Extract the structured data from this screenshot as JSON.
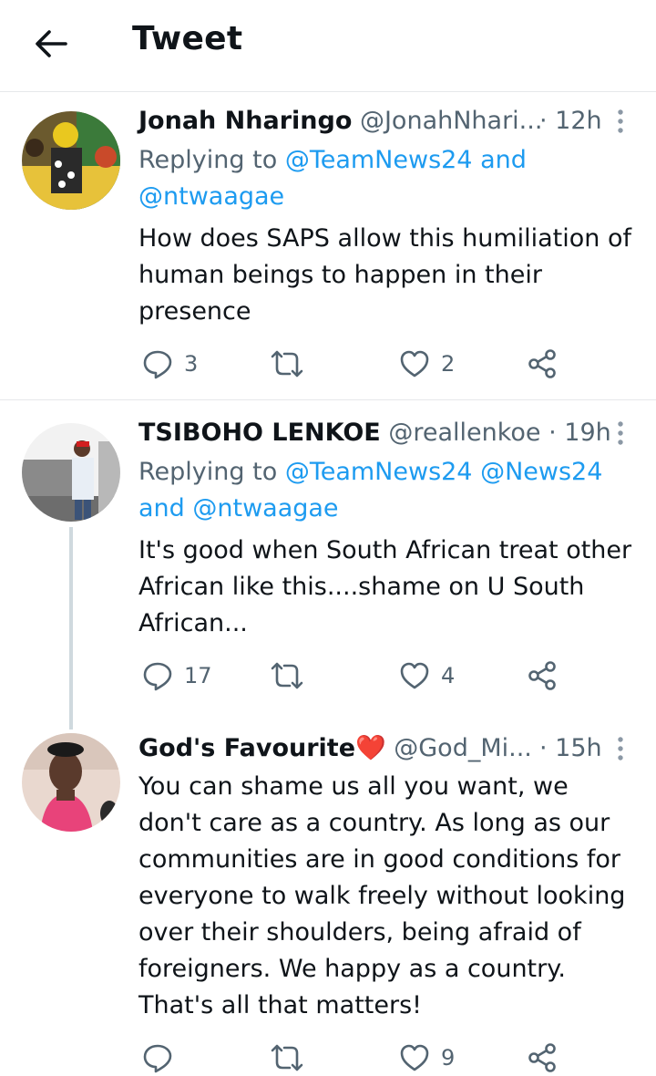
{
  "header": {
    "title": "Tweet",
    "back_icon": "arrow-left-icon"
  },
  "colors": {
    "link": "#1d9bf0",
    "secondary": "#536471",
    "primary_text": "#0f1419",
    "divider": "#e6e8ea",
    "heart_emoji": "#e0245e"
  },
  "tweets": [
    {
      "name": "Jonah Nharingo",
      "handle": "@JonahNhari...",
      "time": "· 12h",
      "replying_prefix": "Replying to",
      "replying_links_line1": "@TeamNews24 and",
      "replying_links_line2": "@ntwaagae",
      "text_lines": [
        "How does SAPS allow this humiliation of",
        "human beings to happen in their",
        "presence"
      ],
      "replies": "3",
      "retweets": "",
      "likes": "2"
    },
    {
      "name": "TSIBOHO LENKOE",
      "handle": "@reallenkoe",
      "time": "· 19h",
      "replying_prefix": "Replying to",
      "replying_links_line1": "@TeamNews24 @News24",
      "replying_links_line2": "and @ntwaagae",
      "text_lines": [
        "It's good when South African treat other",
        "African like this....shame on U South",
        "African..."
      ],
      "replies": "17",
      "retweets": "",
      "likes": "4"
    },
    {
      "name": "God's Favourite",
      "name_emoji": "❤️",
      "handle": "@God_Mi...",
      "time": "· 15h",
      "text_lines": [
        "You can shame us all you want, we",
        "don't care as a country. As long as our",
        "communities are in good conditions for",
        "everyone to walk freely without looking",
        "over their shoulders, being afraid of",
        "foreigners. We happy as a country.",
        "That's all that matters!"
      ],
      "replies": "",
      "retweets": "",
      "likes": "9"
    }
  ]
}
